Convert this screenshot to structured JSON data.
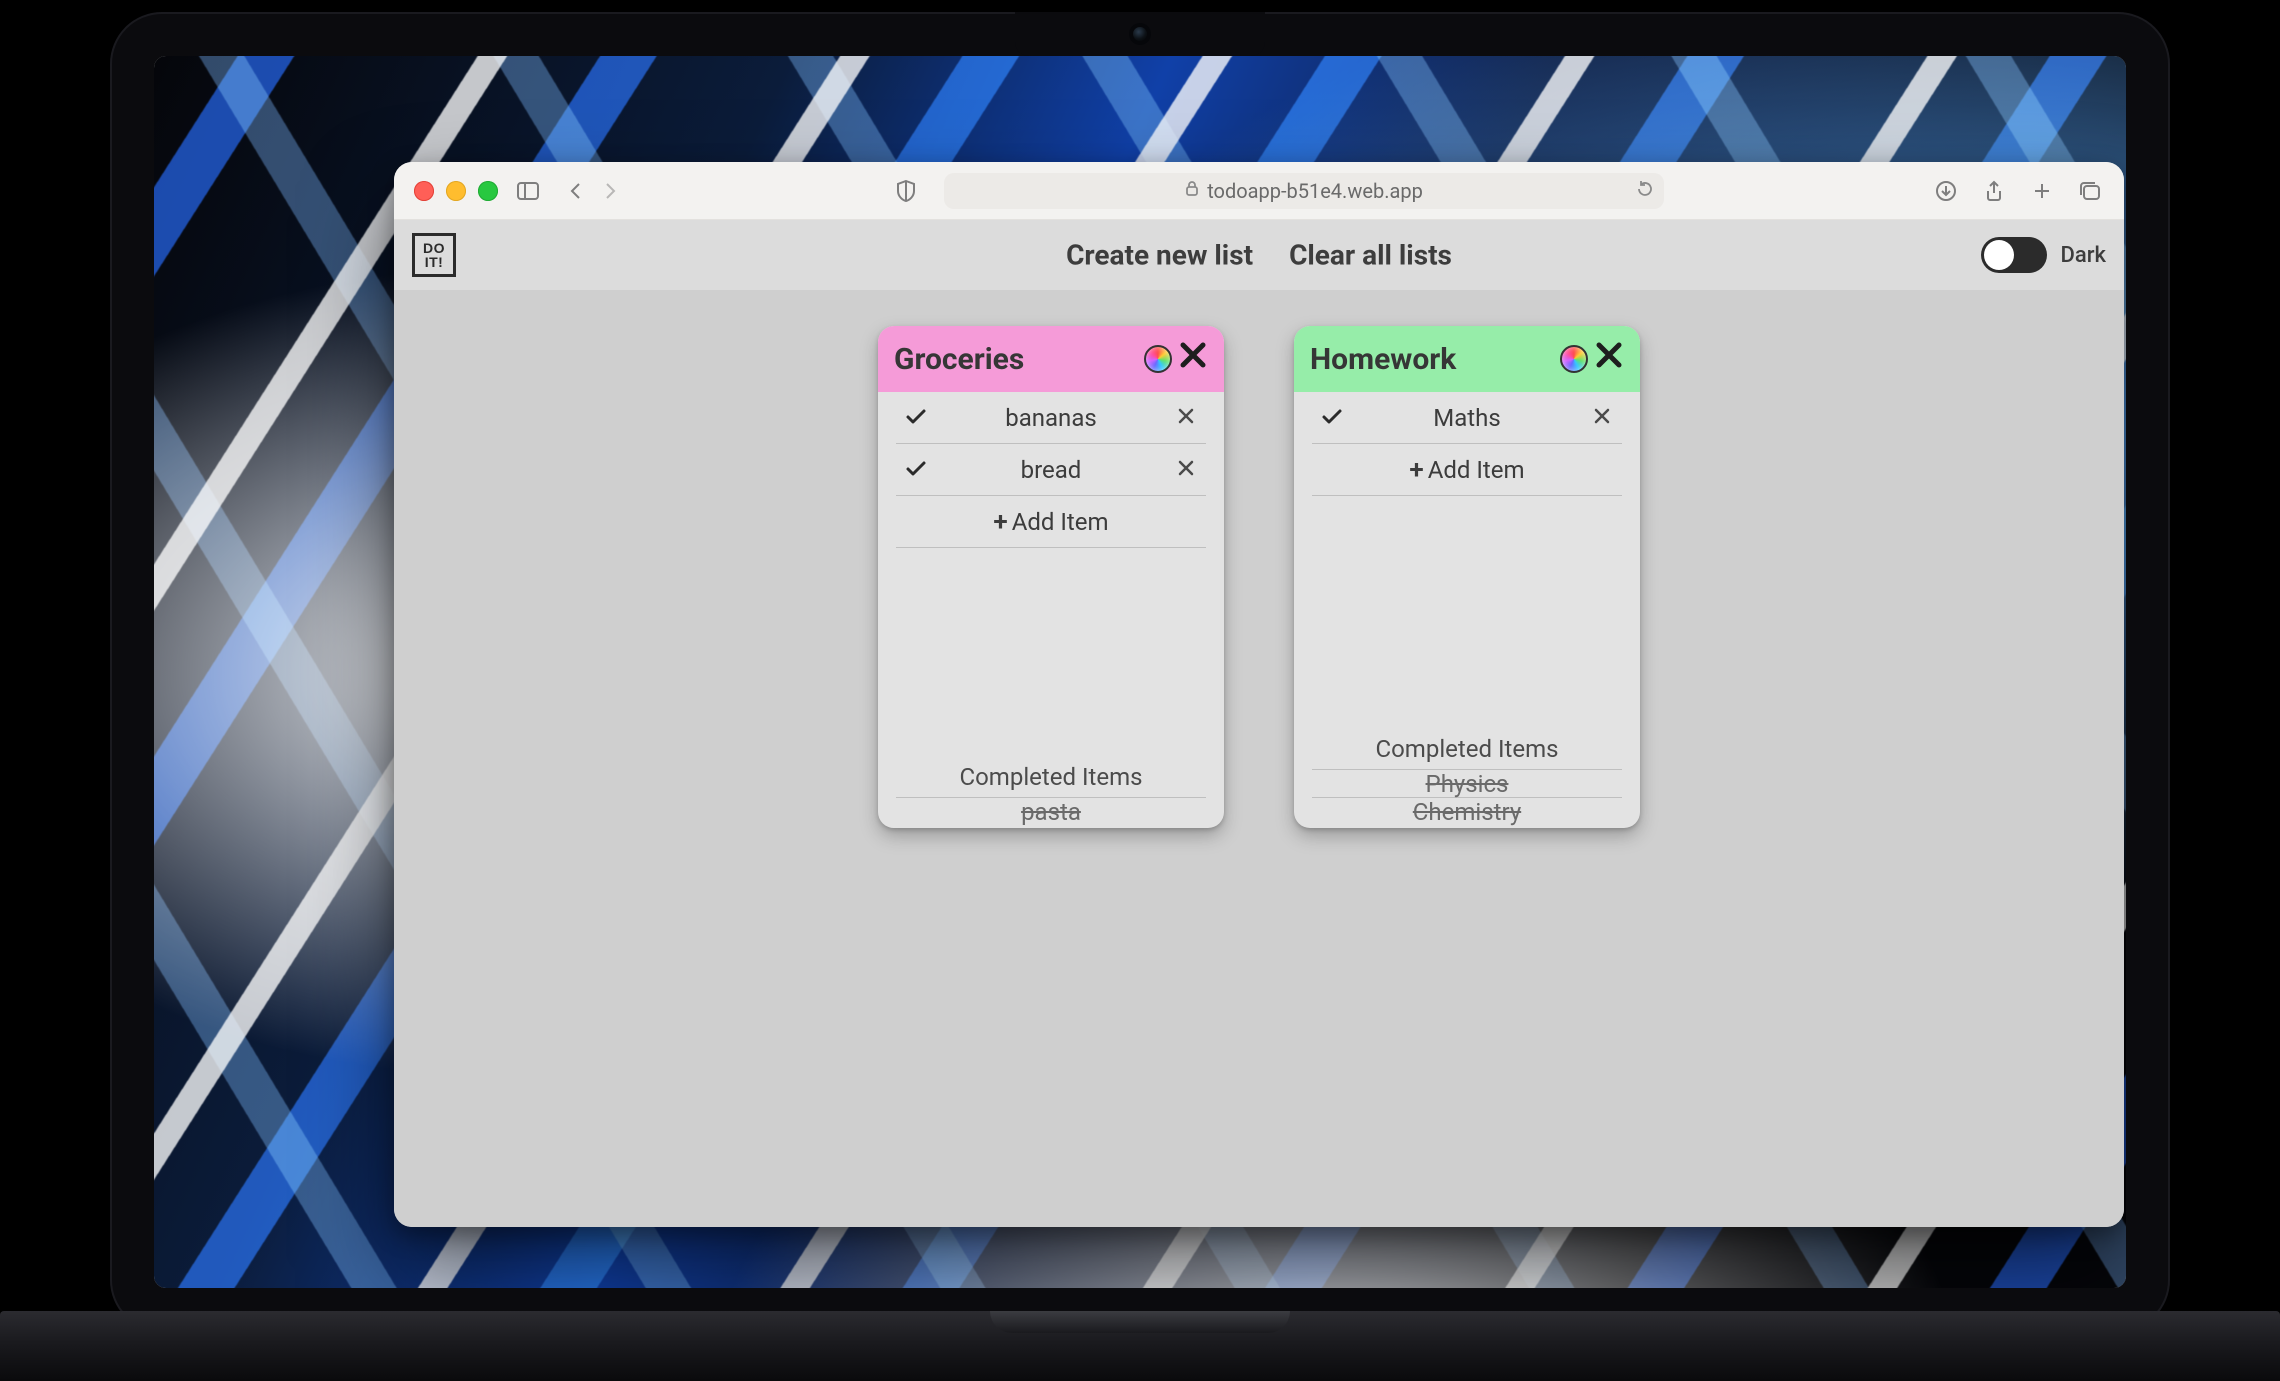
{
  "browser": {
    "url": "todoapp-b51e4.web.app"
  },
  "header": {
    "logo_line1": "DO",
    "logo_line2": "IT!",
    "create_label": "Create new list",
    "clear_label": "Clear all lists",
    "theme_label": "Dark"
  },
  "lists": [
    {
      "title": "Groceries",
      "color": "pink",
      "items": [
        {
          "label": "bananas"
        },
        {
          "label": "bread"
        }
      ],
      "add_label": "Add Item",
      "completed_header": "Completed Items",
      "completed": [
        {
          "label": "pasta"
        }
      ]
    },
    {
      "title": "Homework",
      "color": "green",
      "items": [
        {
          "label": "Maths"
        }
      ],
      "add_label": "Add Item",
      "completed_header": "Completed Items",
      "completed": [
        {
          "label": "Physics"
        },
        {
          "label": "Chemistry"
        }
      ]
    }
  ]
}
